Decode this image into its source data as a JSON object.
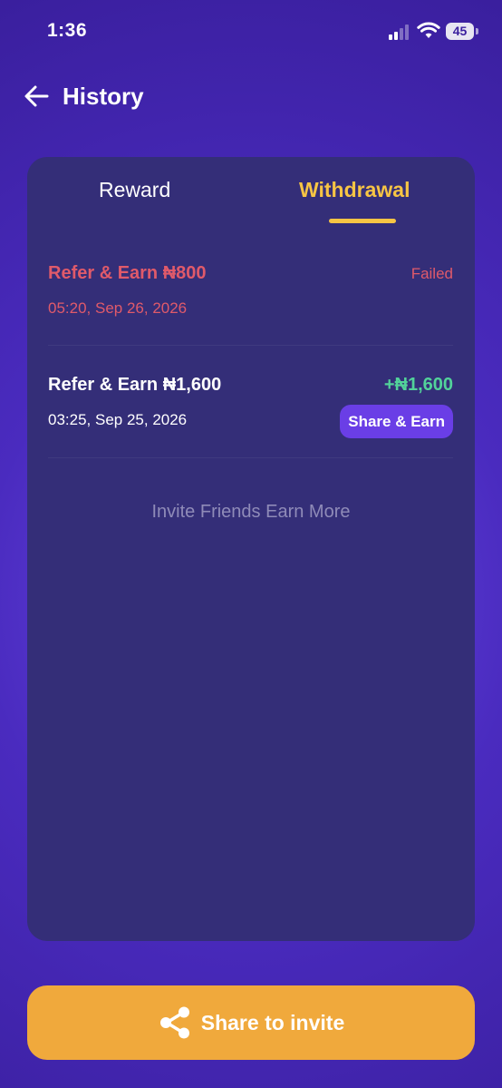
{
  "status_bar": {
    "time": "1:36",
    "battery": "45"
  },
  "header": {
    "back_icon": "arrow-left-icon",
    "title": "History"
  },
  "tabs": [
    {
      "label": "Reward",
      "active": false
    },
    {
      "label": "Withdrawal",
      "active": true
    }
  ],
  "transactions": [
    {
      "title": "Refer & Earn ₦800",
      "date": "05:20, Sep 26, 2026",
      "status": "Failed"
    },
    {
      "title": "Refer & Earn ₦1,600",
      "date": "03:25, Sep 25, 2026",
      "amount": "+₦1,600",
      "action_label": "Share & Earn"
    }
  ],
  "invite_text": "Invite Friends Earn More",
  "footer": {
    "share_icon": "share-icon",
    "button_label": "Share to invite"
  },
  "colors": {
    "accent": "#f7c544",
    "failed": "#e05a6a",
    "success": "#52d29a",
    "button": "#f0a93c",
    "card": "#342e78"
  }
}
